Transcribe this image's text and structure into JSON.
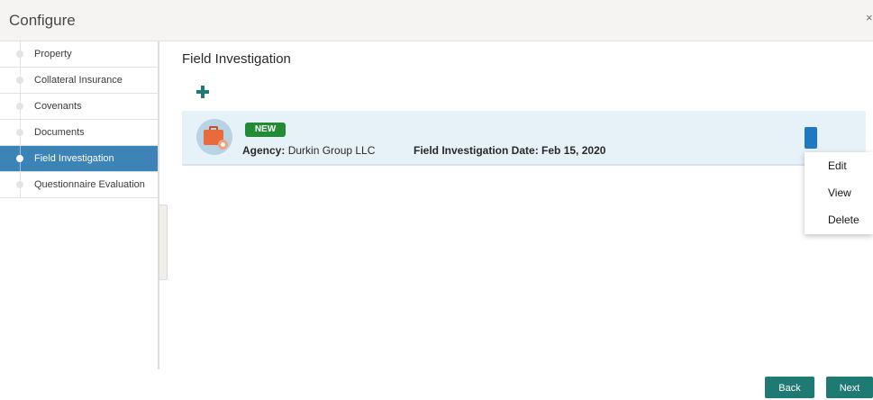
{
  "header": {
    "title": "Configure",
    "close_label": "×"
  },
  "sidebar": {
    "items": [
      {
        "label": "Property",
        "active": false
      },
      {
        "label": "Collateral Insurance",
        "active": false
      },
      {
        "label": "Covenants",
        "active": false
      },
      {
        "label": "Documents",
        "active": false
      },
      {
        "label": "Field Investigation",
        "active": true
      },
      {
        "label": "Questionnaire Evaluation",
        "active": false
      }
    ]
  },
  "main": {
    "title": "Field Investigation",
    "add_icon": "plus-icon",
    "card": {
      "avatar_icon": "briefcase-gear-icon",
      "badge": "NEW",
      "agency_label": "Agency:",
      "agency_value": "Durkin Group LLC",
      "date_label": "Field Investigation Date:",
      "date_value": "Feb 15, 2020"
    },
    "menu": {
      "items": [
        "Edit",
        "View",
        "Delete"
      ]
    }
  },
  "footer": {
    "back_label": "Back",
    "next_label": "Next"
  },
  "colors": {
    "accent": "#3c84b8",
    "button": "#1f7a73",
    "badge": "#218b35",
    "card_bg": "#e6f1f8",
    "kebab": "#1f78c2"
  }
}
